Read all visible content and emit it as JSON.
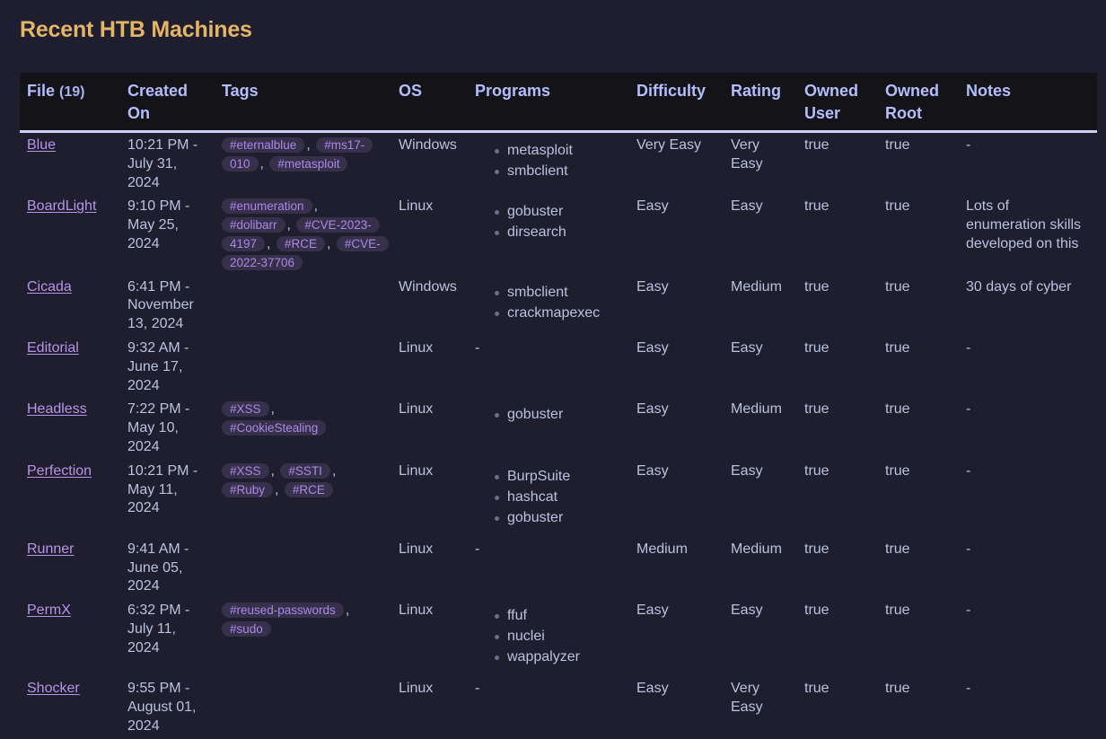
{
  "title": "Recent HTB Machines",
  "table": {
    "file_count": "(19)",
    "headers": {
      "file": "File",
      "created": "Created On",
      "tags": "Tags",
      "os": "OS",
      "programs": "Programs",
      "difficulty": "Difficulty",
      "rating": "Rating",
      "owned_user": "Owned User",
      "owned_root": "Owned Root",
      "notes": "Notes"
    },
    "rows": [
      {
        "file": "Blue",
        "created": "10:21 PM - July 31, 2024",
        "tags": [
          "#eternalblue",
          "#ms17-010",
          "#metasploit"
        ],
        "os": "Windows",
        "programs": [
          "metasploit",
          "smbclient"
        ],
        "difficulty": "Very Easy",
        "rating": "Very Easy",
        "owned_user": "true",
        "owned_root": "true",
        "notes": "-"
      },
      {
        "file": "BoardLight",
        "created": "9:10 PM - May 25, 2024",
        "tags": [
          "#enumeration",
          "#dolibarr",
          "#CVE-2023-4197",
          "#RCE",
          "#CVE-2022-37706"
        ],
        "os": "Linux",
        "programs": [
          "gobuster",
          "dirsearch"
        ],
        "difficulty": "Easy",
        "rating": "Easy",
        "owned_user": "true",
        "owned_root": "true",
        "notes": "Lots of enumeration skills developed on this"
      },
      {
        "file": "Cicada",
        "created": "6:41 PM - November 13, 2024",
        "tags": [],
        "os": "Windows",
        "programs": [
          "smbclient",
          "crackmapexec"
        ],
        "difficulty": "Easy",
        "rating": "Medium",
        "owned_user": "true",
        "owned_root": "true",
        "notes": "30 days of cyber"
      },
      {
        "file": "Editorial",
        "created": "9:32 AM - June 17, 2024",
        "tags": [],
        "os": "Linux",
        "programs": [],
        "programs_empty": "-",
        "difficulty": "Easy",
        "rating": "Easy",
        "owned_user": "true",
        "owned_root": "true",
        "notes": "-"
      },
      {
        "file": "Headless",
        "created": "7:22 PM - May 10, 2024",
        "tags": [
          "#XSS",
          "#CookieStealing"
        ],
        "os": "Linux",
        "programs": [
          "gobuster"
        ],
        "difficulty": "Easy",
        "rating": "Medium",
        "owned_user": "true",
        "owned_root": "true",
        "notes": "-"
      },
      {
        "file": "Perfection",
        "created": "10:21 PM - May 11, 2024",
        "tags": [
          "#XSS",
          "#SSTI",
          "#Ruby",
          "#RCE"
        ],
        "os": "Linux",
        "programs": [
          "BurpSuite",
          "hashcat",
          "gobuster"
        ],
        "difficulty": "Easy",
        "rating": "Easy",
        "owned_user": "true",
        "owned_root": "true",
        "notes": "-"
      },
      {
        "file": "Runner",
        "created": "9:41 AM - June 05, 2024",
        "tags": [],
        "os": "Linux",
        "programs": [],
        "programs_empty": "-",
        "difficulty": "Medium",
        "rating": "Medium",
        "owned_user": "true",
        "owned_root": "true",
        "notes": "-"
      },
      {
        "file": "PermX",
        "created": "6:32 PM - July 11, 2024",
        "tags": [
          "#reused-passwords",
          "#sudo"
        ],
        "os": "Linux",
        "programs": [
          "ffuf",
          "nuclei",
          "wappalyzer"
        ],
        "difficulty": "Easy",
        "rating": "Easy",
        "owned_user": "true",
        "owned_root": "true",
        "notes": "-"
      },
      {
        "file": "Shocker",
        "created": "9:55 PM - August 01, 2024",
        "tags": [],
        "os": "Linux",
        "programs": [],
        "programs_empty": "-",
        "difficulty": "Easy",
        "rating": "Very Easy",
        "owned_user": "true",
        "owned_root": "true",
        "notes": "-"
      }
    ]
  },
  "colors": {
    "background": "#1e1e2e",
    "title": "#e5b567",
    "header_text": "#b4befe",
    "header_bg": "#131318",
    "link": "#b794e8",
    "tag_bg": "#36304a",
    "tag_text": "#a988e8",
    "body_text": "#bac2de"
  }
}
